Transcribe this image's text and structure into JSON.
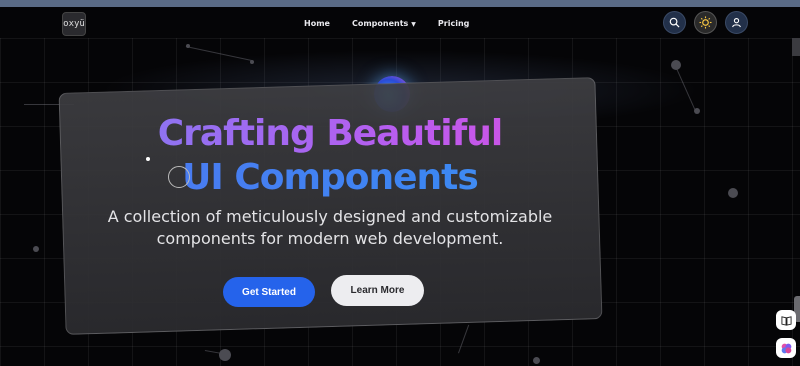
{
  "header": {
    "logo_text": "oxyü",
    "nav": [
      {
        "label": "Home"
      },
      {
        "label": "Components"
      },
      {
        "label": "Pricing"
      }
    ],
    "icons": [
      "search-icon",
      "sun-icon",
      "user-icon"
    ]
  },
  "hero": {
    "title_line1": "Crafting Beautiful",
    "title_line2": "UI Components",
    "subtitle_line1": "A collection of meticulously designed and customizable",
    "subtitle_line2": "components for modern web development.",
    "primary_button": "Get Started",
    "secondary_button": "Learn More"
  },
  "side_buttons": [
    "book-icon",
    "brain-icon"
  ],
  "colors": {
    "accent": "#2563eb",
    "title_gradient_start": "#7e7cf2",
    "title_gradient_end": "#d84fe0",
    "background": "#050507"
  }
}
